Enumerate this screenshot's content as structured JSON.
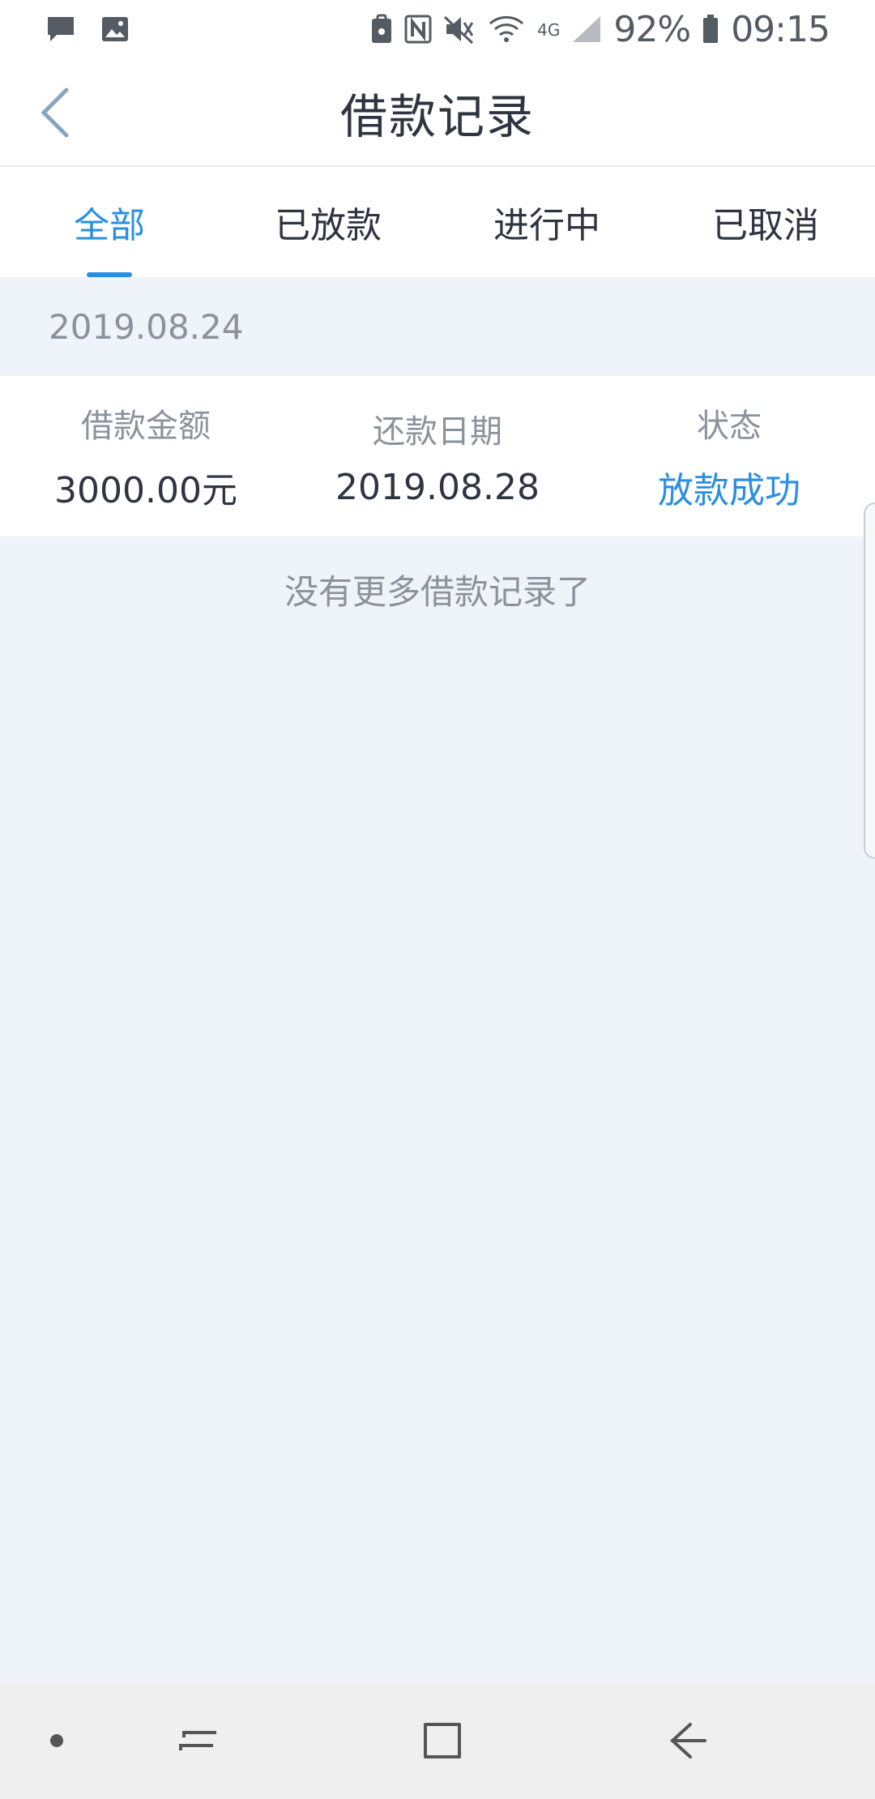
{
  "status_bar": {
    "battery_text": "92%",
    "time": "09:15",
    "network_label": "4G",
    "left_icons": [
      "message-icon",
      "image-icon"
    ],
    "right_icons": [
      "lock-icon",
      "nfc-icon",
      "mute-icon",
      "wifi-icon",
      "signal-icon",
      "battery-icon"
    ]
  },
  "header": {
    "title": "借款记录",
    "back_icon": "chevron-left-icon"
  },
  "tabs": [
    {
      "label": "全部",
      "active": true
    },
    {
      "label": "已放款",
      "active": false
    },
    {
      "label": "进行中",
      "active": false
    },
    {
      "label": "已取消",
      "active": false
    }
  ],
  "records": {
    "group_date": "2019.08.24",
    "columns": [
      {
        "label": "借款金额",
        "value": "3000.00元"
      },
      {
        "label": "还款日期",
        "value": "2019.08.28"
      },
      {
        "label": "状态",
        "value": "放款成功"
      }
    ]
  },
  "empty_message": "没有更多借款记录了",
  "nav_bar": {
    "icons": [
      "dot-icon",
      "recent-apps-icon",
      "home-icon",
      "back-icon"
    ]
  },
  "colors": {
    "accent": "#2b8fe0",
    "background": "#eff3fa",
    "text_primary": "#2e3440",
    "text_secondary": "#8a929c"
  }
}
